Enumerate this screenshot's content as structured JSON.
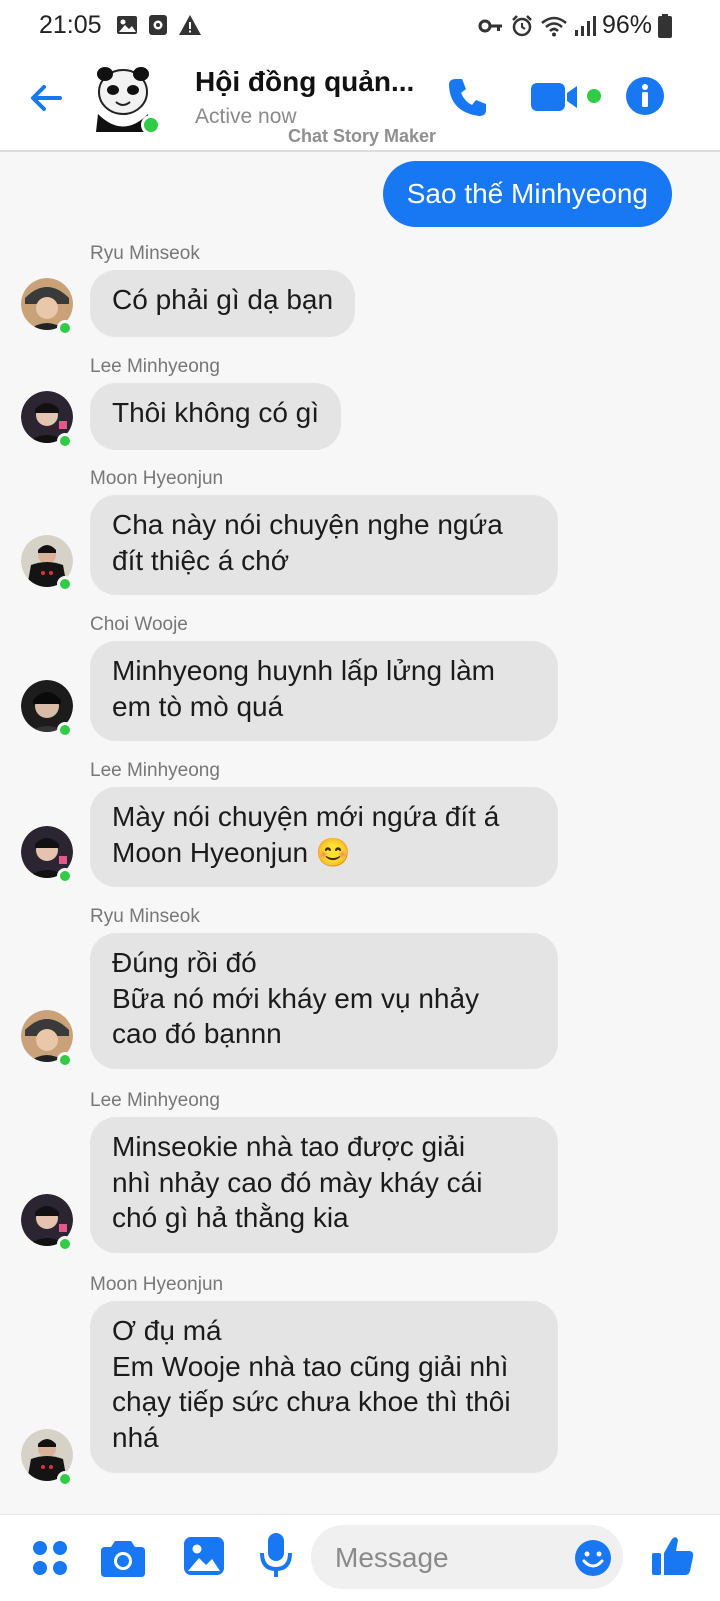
{
  "status_bar": {
    "time": "21:05",
    "battery": "96%"
  },
  "header": {
    "title": "Hội đồng quản...",
    "subtitle": "Active now",
    "watermark": "Chat Story Maker"
  },
  "outgoing": {
    "text": "Sao thế Minhyeong"
  },
  "messages": [
    {
      "sender": "Ryu Minseok",
      "text": "Có phải gì dạ bạn"
    },
    {
      "sender": "Lee Minhyeong",
      "text": "Thôi không có gì"
    },
    {
      "sender": "Moon Hyeonjun",
      "text": "Cha này nói chuyện nghe ngứa\nđít thiệc á chớ"
    },
    {
      "sender": "Choi Wooje",
      "text": "Minhyeong huynh lấp lửng làm\nem tò mò quá"
    },
    {
      "sender": "Lee Minhyeong",
      "text": "Mày nói chuyện mới ngứa đít á\nMoon Hyeonjun 😊"
    },
    {
      "sender": "Ryu Minseok",
      "text": "Đúng rồi đó\nBữa nó mới kháy em vụ nhảy\ncao đó bạnnn"
    },
    {
      "sender": "Lee Minhyeong",
      "text": "Minseokie nhà tao được giải\nnhì nhảy cao đó mày kháy cái\nchó gì hả thằng kia"
    },
    {
      "sender": "Moon Hyeonjun",
      "text": "Ơ đụ má\nEm Wooje nhà tao cũng giải nhì\nchạy tiếp sức chưa khoe thì thôi\nnhá"
    }
  ],
  "composer": {
    "placeholder": "Message"
  },
  "colors": {
    "accent": "#1877f2",
    "online": "#31cc46",
    "incoming_bubble": "#e4e4e4"
  }
}
